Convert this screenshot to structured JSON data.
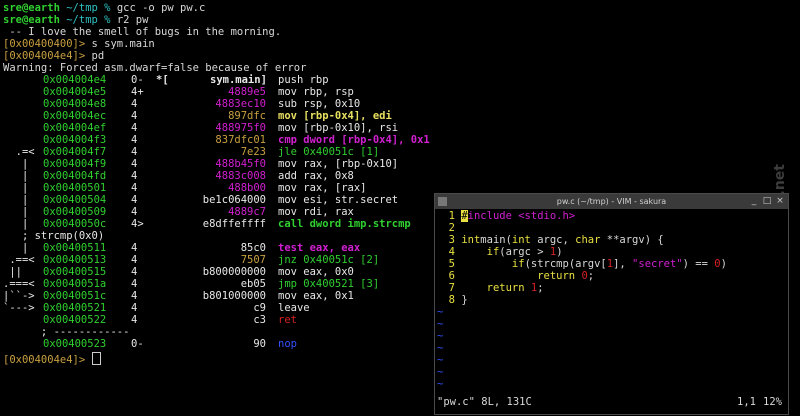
{
  "prompt_user": "sre@earth",
  "prompt_path": " ~/tmp % ",
  "cmd1": "gcc -o pw pw.c",
  "cmd2": "r2 pw",
  "fortune": " -- I love the smell of bugs in the morning.",
  "r2_prompt1": "[0x00400400]>",
  "r2_cmd1": " s sym.main",
  "r2_prompt2": "[0x004004e4]>",
  "r2_cmd2": " pd",
  "warning": "Warning: Forced asm.dwarf=false because of error",
  "disasm": [
    {
      "flow": "      ",
      "addr": "0x004004e4",
      "sz": "0-",
      "mk": "*[",
      "bytes": "",
      "bcls": "",
      "sym": "sym.main]",
      "op": "push rbp",
      "ocls": "white"
    },
    {
      "flow": "      ",
      "addr": "0x004004e5",
      "sz": "4+",
      "mk": "",
      "bytes": "4889e5",
      "bcls": "mag",
      "op": "mov rbp, rsp",
      "ocls": "white"
    },
    {
      "flow": "      ",
      "addr": "0x004004e8",
      "sz": "4",
      "mk": "",
      "bytes": "4883ec10",
      "bcls": "mag",
      "op": "sub rsp, 0x10",
      "ocls": "white"
    },
    {
      "flow": "      ",
      "addr": "0x004004ec",
      "sz": "4",
      "mk": "",
      "bytes": "897dfc",
      "bcls": "orange",
      "op": "mov [rbp-0x4], edi",
      "ocls": "yellow"
    },
    {
      "flow": "      ",
      "addr": "0x004004ef",
      "sz": "4",
      "mk": "",
      "bytes": "488975f0",
      "bcls": "mag",
      "op": "mov [rbp-0x10], rsi",
      "ocls": "white"
    },
    {
      "flow": "      ",
      "addr": "0x004004f3",
      "sz": "4",
      "mk": "",
      "bytes": "837dfc01",
      "bcls": "orange",
      "op": "cmp dword [rbp-0x4], 0x1",
      "ocls": "mag bold"
    },
    {
      "flow": "  .=< ",
      "addr": "0x004004f7",
      "sz": "4",
      "mk": "",
      "bytes": "7e23",
      "bcls": "orange",
      "op": "jle 0x40051c [1]",
      "ocls": "green"
    },
    {
      "flow": "   |  ",
      "addr": "0x004004f9",
      "sz": "4",
      "mk": "",
      "bytes": "488b45f0",
      "bcls": "mag",
      "op": "mov rax, [rbp-0x10]",
      "ocls": "white"
    },
    {
      "flow": "   |  ",
      "addr": "0x004004fd",
      "sz": "4",
      "mk": "",
      "bytes": "4883c008",
      "bcls": "mag",
      "op": "add rax, 0x8",
      "ocls": "white"
    },
    {
      "flow": "   |  ",
      "addr": "0x00400501",
      "sz": "4",
      "mk": "",
      "bytes": "488b00",
      "bcls": "mag",
      "op": "mov rax, [rax]",
      "ocls": "white"
    },
    {
      "flow": "   |  ",
      "addr": "0x00400504",
      "sz": "4",
      "mk": "",
      "bytes": "be1c064000",
      "bcls": "white",
      "op": "mov esi, str.secret",
      "ocls": "white"
    },
    {
      "flow": "   |  ",
      "addr": "0x00400509",
      "sz": "4",
      "mk": "",
      "bytes": "4889c7",
      "bcls": "mag",
      "op": "mov rdi, rax",
      "ocls": "white"
    },
    {
      "flow": "   |  ",
      "addr": "0x0040050c",
      "sz": "4>",
      "mk": "",
      "bytes": "e8dffeffff",
      "bcls": "white",
      "op": "call dword imp.strcmp",
      "ocls": "green bold"
    },
    {
      "flow": "   ; strcmp(0x0)",
      "addr": "",
      "sz": "",
      "mk": "",
      "bytes": "",
      "bcls": "",
      "op": "",
      "ocls": ""
    },
    {
      "flow": "   |  ",
      "addr": "0x00400511",
      "sz": "4",
      "mk": "",
      "bytes": "85c0",
      "bcls": "white",
      "op": "test eax, eax",
      "ocls": "mag bold"
    },
    {
      "flow": " .==< ",
      "addr": "0x00400513",
      "sz": "4",
      "mk": "",
      "bytes": "7507",
      "bcls": "orange",
      "op": "jnz 0x40051c [2]",
      "ocls": "green"
    },
    {
      "flow": " ||   ",
      "addr": "0x00400515",
      "sz": "4",
      "mk": "",
      "bytes": "b800000000",
      "bcls": "white",
      "op": "mov eax, 0x0",
      "ocls": "white"
    },
    {
      "flow": ".===< ",
      "addr": "0x0040051a",
      "sz": "4",
      "mk": "",
      "bytes": "eb05",
      "bcls": "white",
      "op": "jmp 0x400521 [3]",
      "ocls": "green"
    },
    {
      "flow": "|``-> ",
      "addr": "0x0040051c",
      "sz": "4",
      "mk": "",
      "bytes": "b801000000",
      "bcls": "white",
      "op": "mov eax, 0x1",
      "ocls": "white"
    },
    {
      "flow": "`---> ",
      "addr": "0x00400521",
      "sz": "4",
      "mk": "",
      "bytes": "c9",
      "bcls": "white",
      "op": "leave",
      "ocls": "white"
    },
    {
      "flow": "      ",
      "addr": "0x00400522",
      "sz": "4",
      "mk": "",
      "bytes": "c3",
      "bcls": "white",
      "op": "ret",
      "ocls": "red"
    },
    {
      "flow": "      ; ------------",
      "addr": "",
      "sz": "",
      "mk": "",
      "bytes": "",
      "bcls": "",
      "op": "",
      "ocls": ""
    },
    {
      "flow": "      ",
      "addr": "0x00400523",
      "sz": "0-",
      "mk": "",
      "bytes": "90",
      "bcls": "white",
      "op": "nop",
      "ocls": "blue"
    }
  ],
  "r2_prompt3": "[0x004004e4]>",
  "vim": {
    "title": "pw.c (~/tmp) - VIM - sakura",
    "lines": [
      {
        "n": "1",
        "parts": [
          [
            "vim-cur",
            "#"
          ],
          [
            "pre",
            "include <stdio.h>"
          ]
        ]
      },
      {
        "n": "2",
        "parts": []
      },
      {
        "n": "3",
        "parts": [
          [
            "kw",
            "int"
          ],
          [
            "",
            "main("
          ],
          [
            "kw",
            "int"
          ],
          [
            "",
            " argc, "
          ],
          [
            "kw",
            "char"
          ],
          [
            "",
            " **argv) {"
          ]
        ]
      },
      {
        "n": "4",
        "parts": [
          [
            "",
            "    "
          ],
          [
            "kw",
            "if"
          ],
          [
            "",
            "(argc > "
          ],
          [
            "num",
            "1"
          ],
          [
            "",
            ")"
          ]
        ]
      },
      {
        "n": "5",
        "parts": [
          [
            "",
            "        "
          ],
          [
            "kw",
            "if"
          ],
          [
            "",
            "(strcmp(argv["
          ],
          [
            "num",
            "1"
          ],
          [
            "",
            "], "
          ],
          [
            "str",
            "\"secret\""
          ],
          [
            "",
            ") == "
          ],
          [
            "num",
            "0"
          ],
          [
            "",
            ")"
          ]
        ]
      },
      {
        "n": "6",
        "parts": [
          [
            "",
            "            "
          ],
          [
            "kw",
            "return"
          ],
          [
            "",
            " "
          ],
          [
            "num",
            "0"
          ],
          [
            "",
            ";"
          ]
        ]
      },
      {
        "n": "7",
        "parts": [
          [
            "",
            "    "
          ],
          [
            "kw",
            "return"
          ],
          [
            "",
            " "
          ],
          [
            "num",
            "1"
          ],
          [
            "",
            ";"
          ]
        ]
      },
      {
        "n": "8",
        "parts": [
          [
            "",
            "}"
          ]
        ]
      }
    ],
    "status_left": "\"pw.c\" 8L, 131C",
    "status_pos": "1,1",
    "status_pct": "12%"
  },
  "watermark": "screenshots.debian.net"
}
